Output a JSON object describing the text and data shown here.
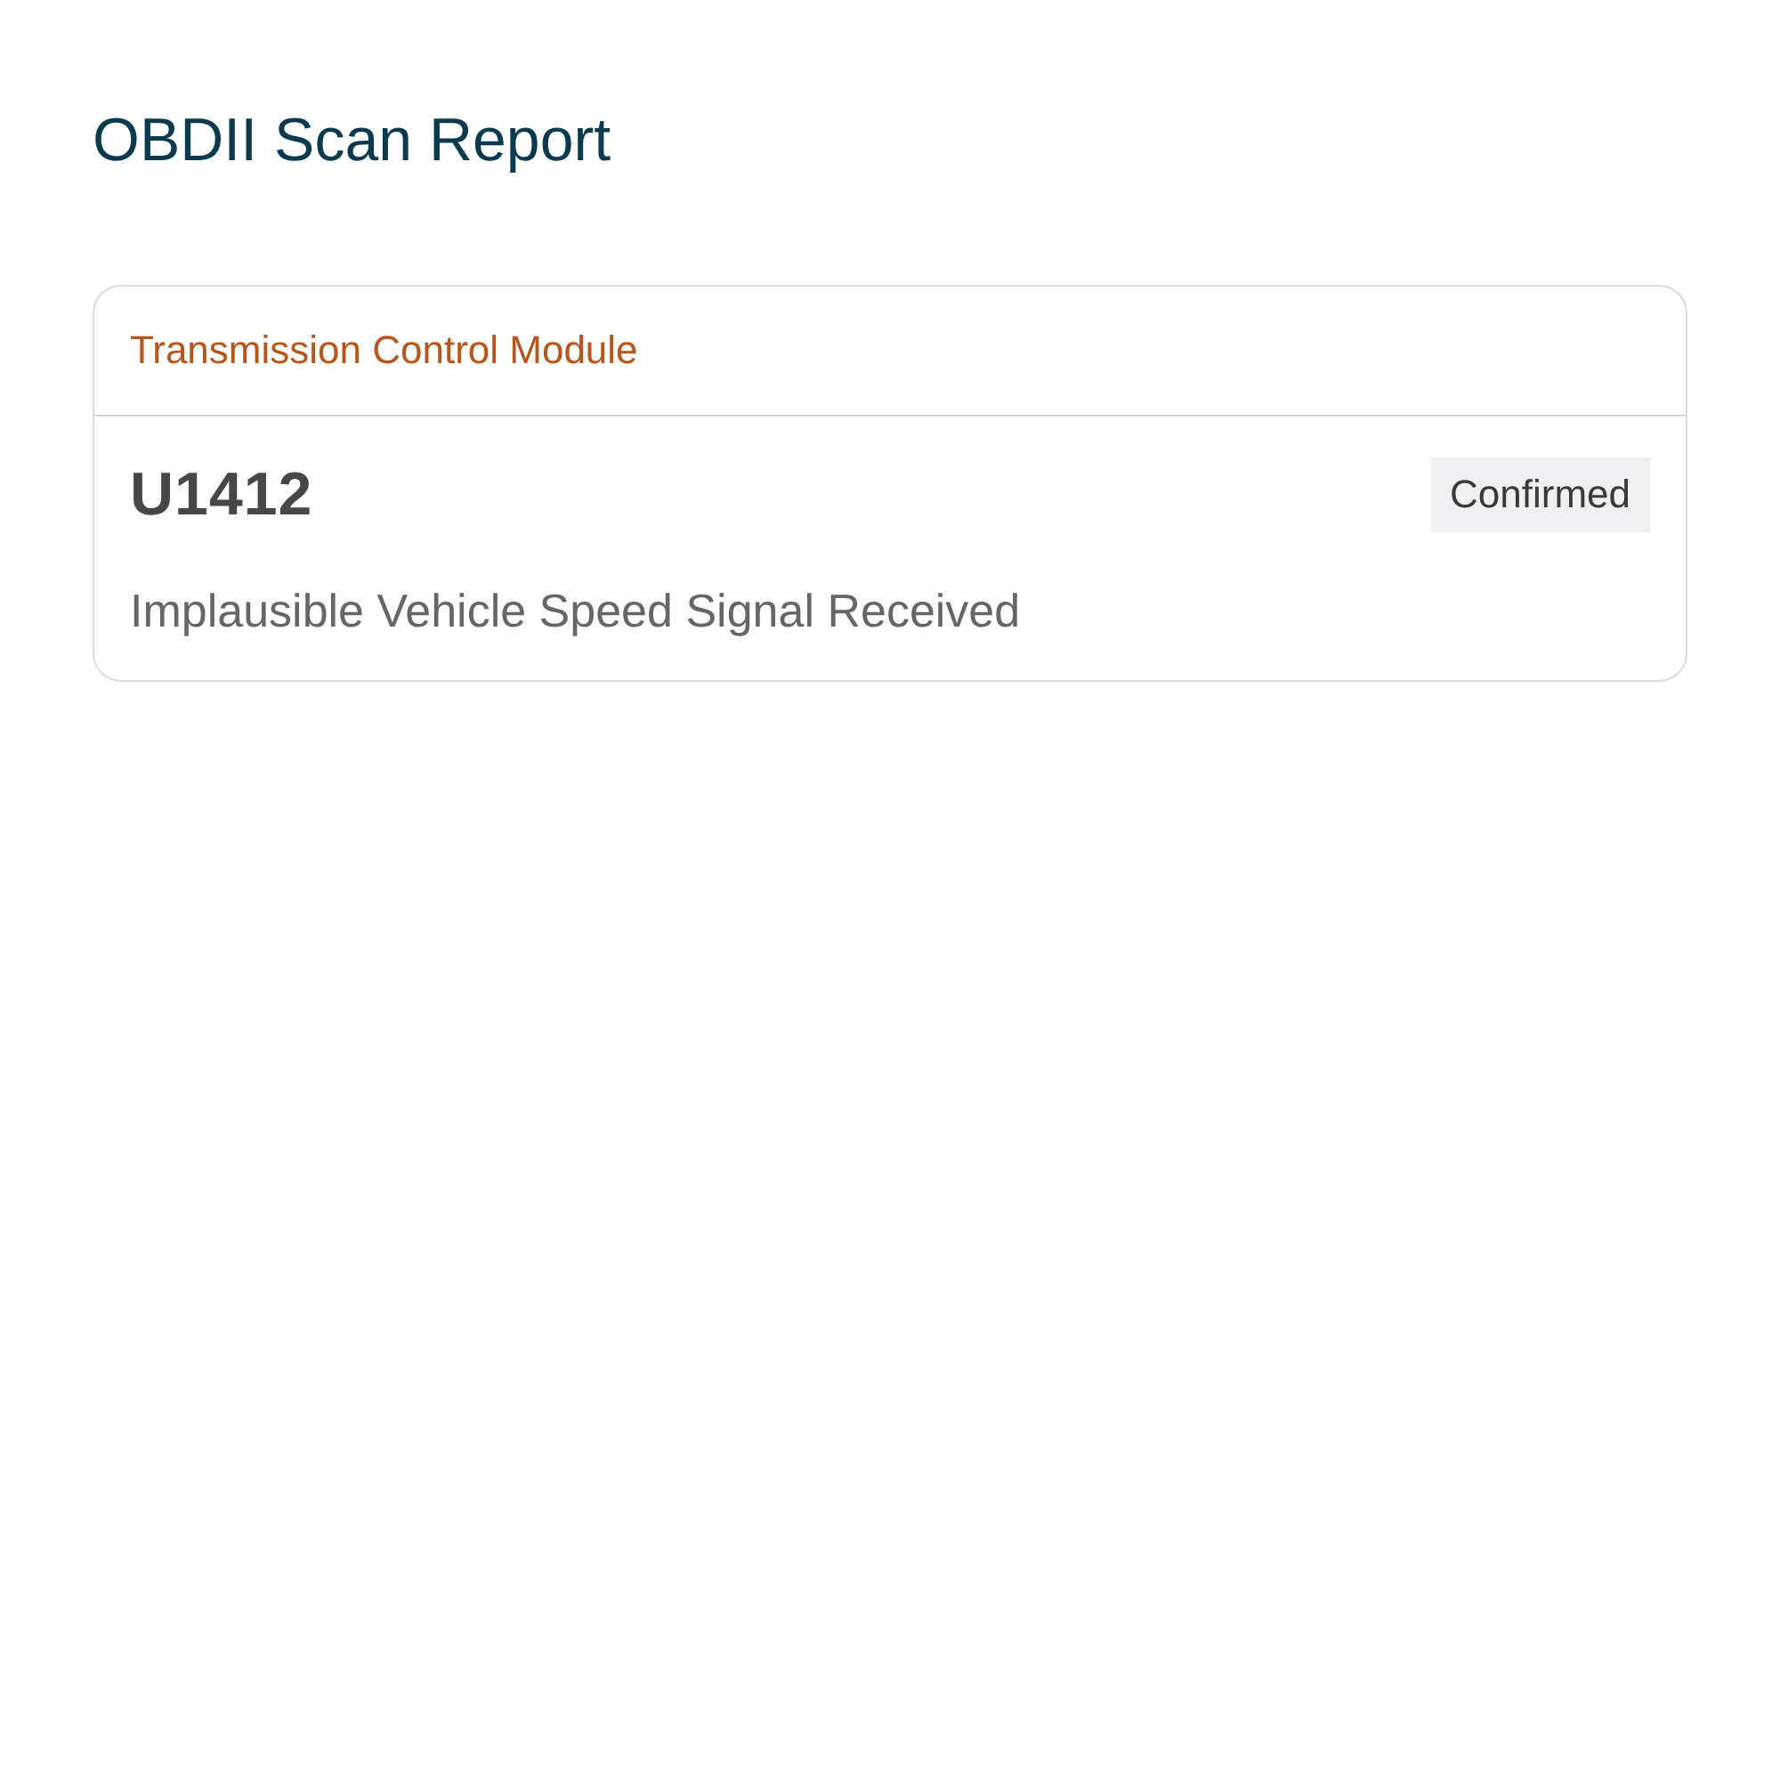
{
  "title": "OBDII Scan Report",
  "modules": [
    {
      "name": "Transmission Control Module",
      "codes": [
        {
          "code": "U1412",
          "status": "Confirmed",
          "description": "Implausible Vehicle Speed Signal Received"
        }
      ]
    }
  ]
}
